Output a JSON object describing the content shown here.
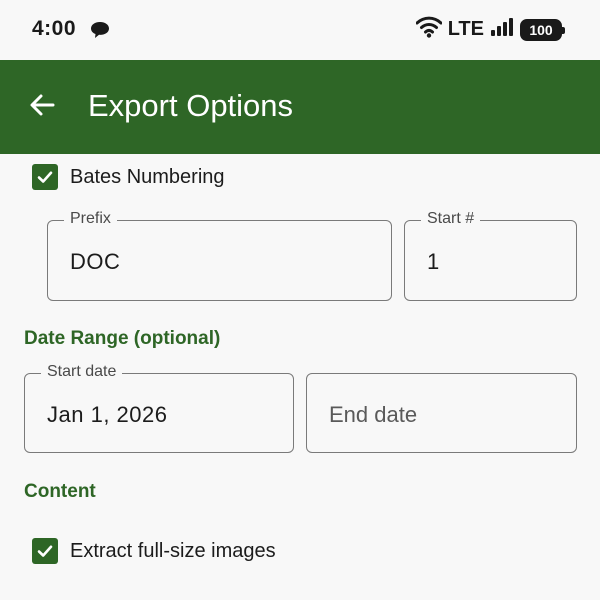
{
  "status_bar": {
    "time": "4:00",
    "network": "LTE",
    "battery": "100"
  },
  "app_bar": {
    "title": "Export Options",
    "back_icon": "arrow-back-icon",
    "color": "#2e6626"
  },
  "bates": {
    "checkbox_label": "Bates Numbering",
    "checked": true,
    "prefix": {
      "label": "Prefix",
      "value": "DOC"
    },
    "start": {
      "label": "Start #",
      "value": "1"
    }
  },
  "date_range": {
    "heading": "Date Range (optional)",
    "start": {
      "label": "Start date",
      "value": "Jan 1, 2026"
    },
    "end": {
      "placeholder": "End date"
    }
  },
  "content": {
    "heading": "Content",
    "extract_images": {
      "label": "Extract full-size images",
      "checked": true
    }
  }
}
